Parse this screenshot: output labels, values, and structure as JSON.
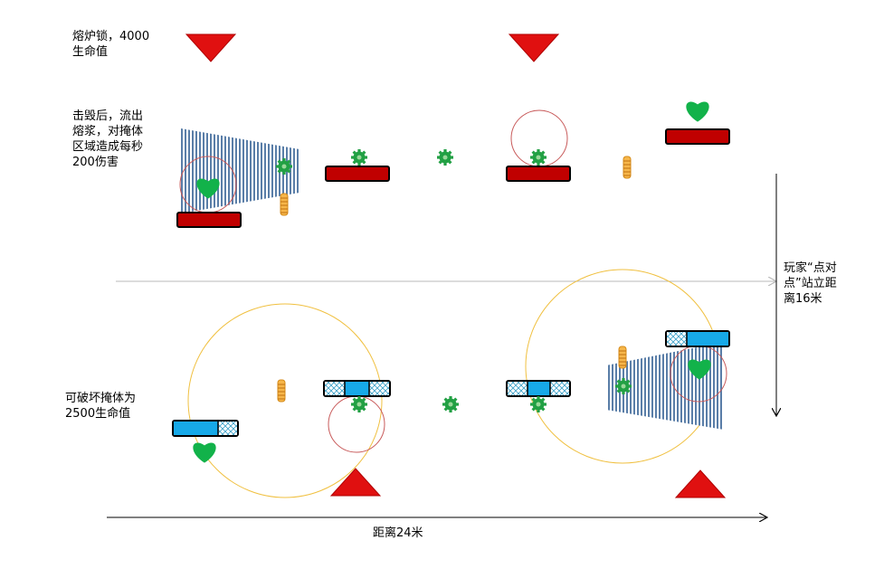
{
  "labels": {
    "furnace_lock": "熔炉锁，4000\n生命值",
    "destroy_effect": "击毁后，流出\n熔浆，对掩体\n区域造成每秒\n200伤害",
    "cover_hp": "可破坏掩体为\n2500生命值",
    "vertical_distance": "玩家“点对\n点”站立距\n离16米",
    "horizontal_distance": "距离24米"
  },
  "icons": {
    "enemy_spawn": "red-down-triangle-icon",
    "ally_spawn": "red-up-triangle-icon",
    "heal_pickup": "green-heart-icon",
    "buff": "green-gear-icon",
    "ammo": "orange-spring-icon"
  },
  "colors": {
    "spawn_red": "#e01010",
    "heart_green": "#12b24a",
    "gear_green": "#22a044",
    "furnace_red": "#c00000",
    "cover_blue": "#17a9e8",
    "spring_orange": "#f0a020",
    "lava_stripes": "#5a7ea8",
    "blast_ring": "#c85a5a",
    "range_ring": "#f0c040",
    "guide_line": "#b8b8b8"
  }
}
